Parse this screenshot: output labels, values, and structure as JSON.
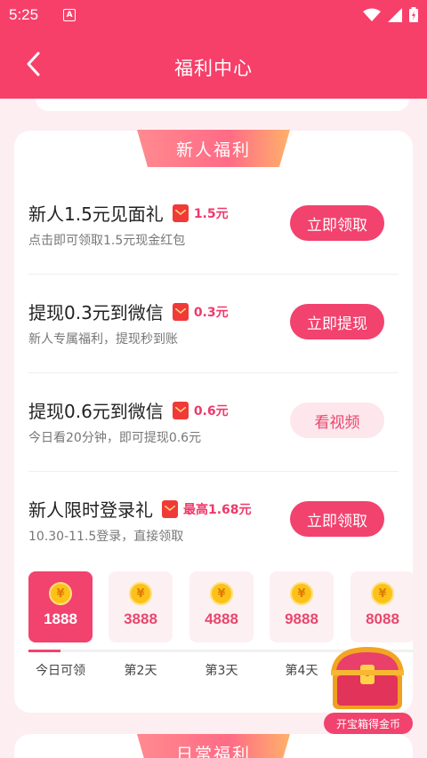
{
  "status_bar": {
    "time": "5:25",
    "notification_badge": "A"
  },
  "header": {
    "title": "福利中心"
  },
  "newcomer": {
    "section_title": "新人福利",
    "tasks": [
      {
        "title": "新人1.5元见面礼",
        "reward": "1.5元",
        "subtitle": "点击即可领取1.5元现金红包",
        "button": "立即领取"
      },
      {
        "title": "提现0.3元到微信",
        "reward": "0.3元",
        "subtitle": "新人专属福利，提现秒到账",
        "button": "立即提现"
      },
      {
        "title": "提现0.6元到微信",
        "reward": "0.6元",
        "subtitle": "今日看20分钟，即可提现0.6元",
        "button": "看视频"
      },
      {
        "title": "新人限时登录礼",
        "reward": "最高1.68元",
        "subtitle": "10.30-11.5登录，直接领取",
        "button": "立即领取"
      }
    ],
    "days": [
      {
        "amount": "1888",
        "label": "今日可领"
      },
      {
        "amount": "3888",
        "label": "第2天"
      },
      {
        "amount": "4888",
        "label": "第3天"
      },
      {
        "amount": "9888",
        "label": "第4天"
      },
      {
        "amount": "8088",
        "label": ""
      }
    ],
    "coin_symbol": "¥"
  },
  "treasure": {
    "label": "开宝箱得金币"
  },
  "daily": {
    "section_title": "日常福利"
  },
  "colors": {
    "brand": "#f6406a",
    "button": "#f2426e",
    "soft_button": "#fde6ec",
    "coin": "#fcc21a"
  },
  "icons": {
    "back": "chevron-left-icon",
    "wifi": "wifi-icon",
    "signal": "signal-icon",
    "battery": "battery-icon",
    "redpack": "red-packet-icon",
    "coin": "coin-icon",
    "chest": "treasure-chest-icon"
  }
}
